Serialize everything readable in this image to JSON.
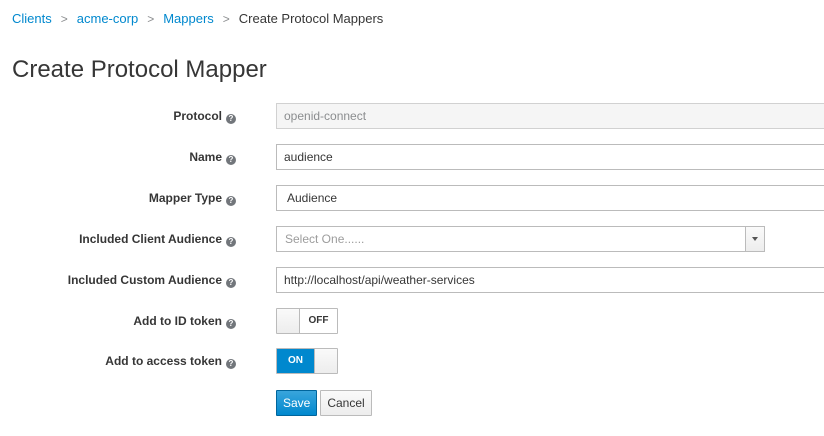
{
  "breadcrumb": {
    "items": [
      "Clients",
      "acme-corp",
      "Mappers"
    ],
    "separator": ">",
    "current": "Create Protocol Mappers"
  },
  "page": {
    "title": "Create Protocol Mapper"
  },
  "form": {
    "protocol": {
      "label": "Protocol",
      "value": "openid-connect"
    },
    "name": {
      "label": "Name",
      "value": "audience"
    },
    "mapper_type": {
      "label": "Mapper Type",
      "value": "Audience"
    },
    "included_client_audience": {
      "label": "Included Client Audience",
      "placeholder": "Select One......"
    },
    "included_custom_audience": {
      "label": "Included Custom Audience",
      "value": "http://localhost/api/weather-services"
    },
    "add_to_id_token": {
      "label": "Add to ID token",
      "state": "OFF",
      "enabled": false
    },
    "add_to_access_token": {
      "label": "Add to access token",
      "state": "ON",
      "enabled": true
    }
  },
  "buttons": {
    "save": "Save",
    "cancel": "Cancel"
  },
  "icons": {
    "help": "question-circle-icon",
    "help_glyph": "?",
    "dropdown": "chevron-down-icon"
  },
  "colors": {
    "accent": "#0088ce",
    "text": "#363636",
    "border": "#bbbbbb"
  }
}
